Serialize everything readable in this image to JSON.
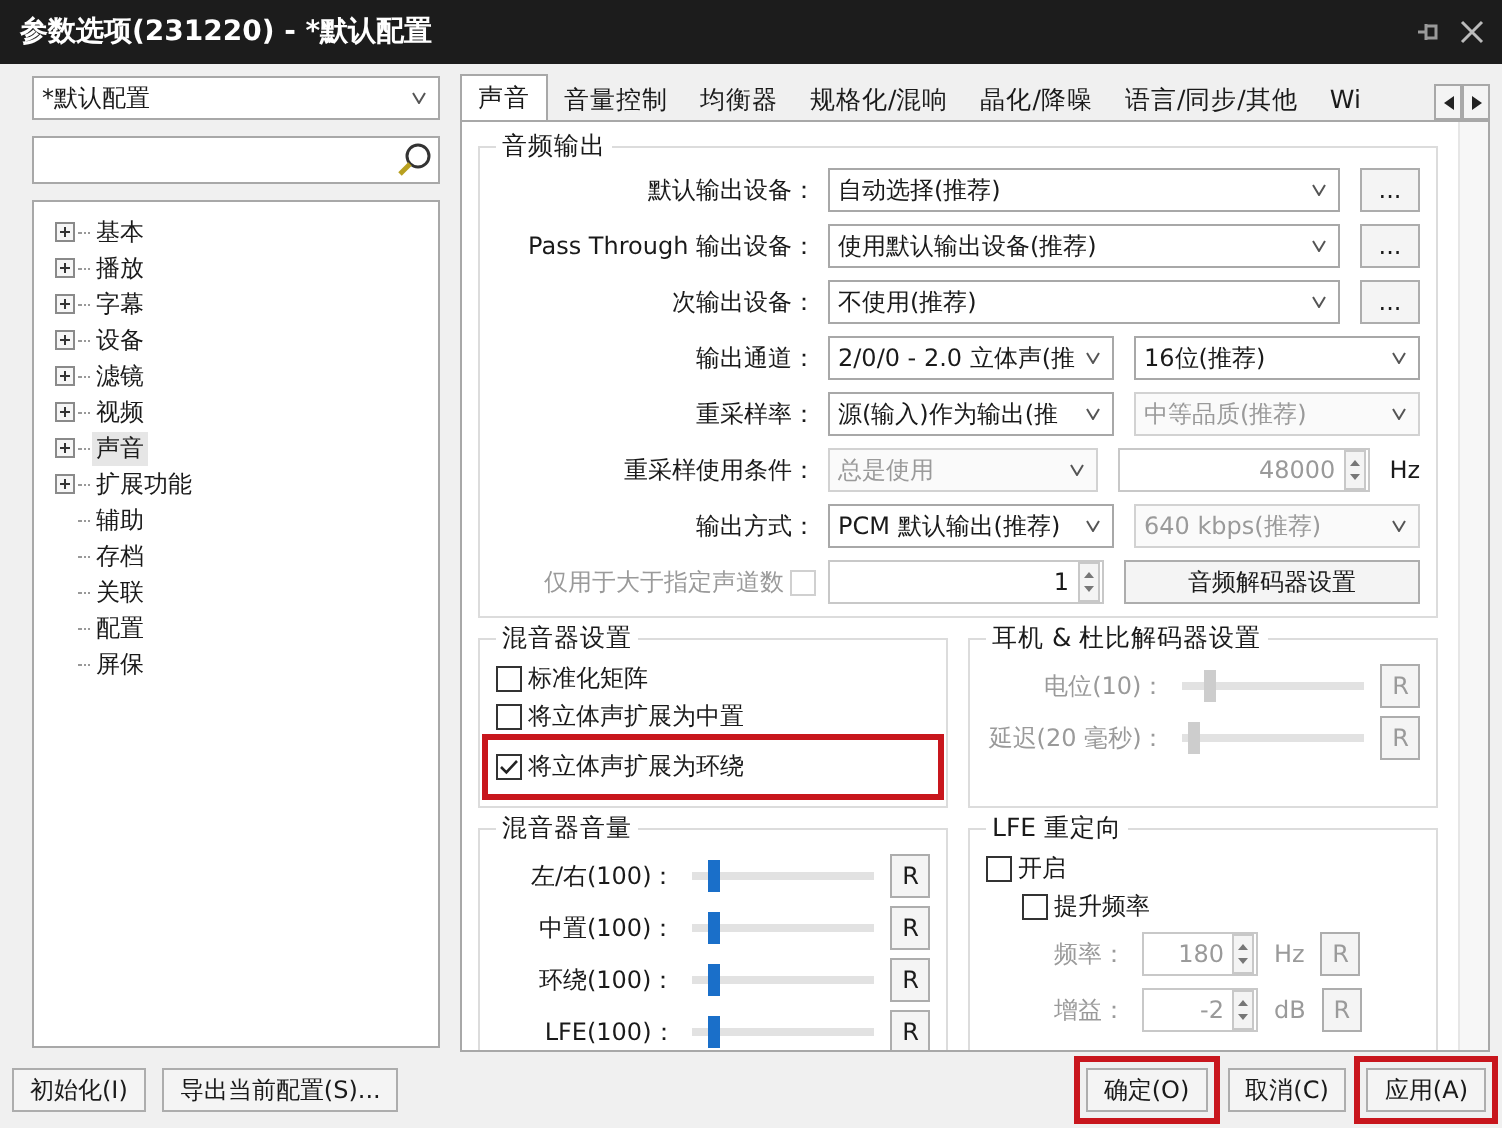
{
  "window": {
    "title": "参数选项(231220) - *默认配置"
  },
  "profile": {
    "value": "*默认配置"
  },
  "tree": [
    {
      "label": "基本",
      "expandable": true,
      "selected": false
    },
    {
      "label": "播放",
      "expandable": true,
      "selected": false
    },
    {
      "label": "字幕",
      "expandable": true,
      "selected": false
    },
    {
      "label": "设备",
      "expandable": true,
      "selected": false
    },
    {
      "label": "滤镜",
      "expandable": true,
      "selected": false
    },
    {
      "label": "视频",
      "expandable": true,
      "selected": false
    },
    {
      "label": "声音",
      "expandable": true,
      "selected": true
    },
    {
      "label": "扩展功能",
      "expandable": true,
      "selected": false
    },
    {
      "label": "辅助",
      "expandable": false,
      "selected": false
    },
    {
      "label": "存档",
      "expandable": false,
      "selected": false
    },
    {
      "label": "关联",
      "expandable": false,
      "selected": false
    },
    {
      "label": "配置",
      "expandable": false,
      "selected": false
    },
    {
      "label": "屏保",
      "expandable": false,
      "selected": false
    }
  ],
  "tabs": [
    {
      "label": "声音",
      "selected": true
    },
    {
      "label": "音量控制",
      "selected": false
    },
    {
      "label": "均衡器",
      "selected": false
    },
    {
      "label": "规格化/混响",
      "selected": false
    },
    {
      "label": "晶化/降噪",
      "selected": false
    },
    {
      "label": "语言/同步/其他",
      "selected": false
    },
    {
      "label": "Wi",
      "selected": false
    }
  ],
  "audio_output": {
    "title": "音频输出",
    "rows": [
      {
        "label": "默认输出设备：",
        "disabled": false,
        "controls": [
          {
            "kind": "combo",
            "value": "自动选择(推荐)",
            "disabled": false
          },
          {
            "kind": "more",
            "text": "...",
            "disabled": false
          }
        ]
      },
      {
        "label": "Pass Through 输出设备：",
        "disabled": false,
        "controls": [
          {
            "kind": "combo",
            "value": "使用默认输出设备(推荐)",
            "disabled": false
          },
          {
            "kind": "more",
            "text": "...",
            "disabled": false
          }
        ]
      },
      {
        "label": "次输出设备：",
        "disabled": false,
        "controls": [
          {
            "kind": "combo",
            "value": "不使用(推荐)",
            "disabled": false
          },
          {
            "kind": "more",
            "text": "...",
            "disabled": false
          }
        ]
      },
      {
        "label": "输出通道：",
        "disabled": false,
        "controls": [
          {
            "kind": "combo",
            "value": "2/0/0 - 2.0 立体声(推",
            "disabled": false
          },
          {
            "kind": "combo",
            "value": "16位(推荐)",
            "disabled": false
          }
        ]
      },
      {
        "label": "重采样率：",
        "disabled": false,
        "controls": [
          {
            "kind": "combo",
            "value": "源(输入)作为输出(推",
            "disabled": false
          },
          {
            "kind": "combo",
            "value": "中等品质(推荐)",
            "disabled": true
          }
        ]
      },
      {
        "label": "重采样使用条件：",
        "disabled": false,
        "controls": [
          {
            "kind": "combo",
            "value": "总是使用",
            "disabled": true
          },
          {
            "kind": "spin",
            "value": "48000",
            "disabled": true
          },
          {
            "kind": "unit",
            "text": "Hz",
            "disabled": false
          }
        ]
      },
      {
        "label": "输出方式：",
        "disabled": false,
        "controls": [
          {
            "kind": "combo",
            "value": "PCM 默认输出(推荐)",
            "disabled": false
          },
          {
            "kind": "combo",
            "value": "640 kbps(推荐)",
            "disabled": true
          }
        ]
      },
      {
        "label": "仅用于大于指定声道数",
        "disabled": true,
        "checkbox": {
          "checked": false,
          "disabled": true
        },
        "controls": [
          {
            "kind": "counter",
            "value": "1",
            "disabled": false
          },
          {
            "kind": "button",
            "text": "音频解码器设置",
            "disabled": false
          }
        ]
      }
    ]
  },
  "mixer_settings": {
    "title": "混音器设置",
    "options": [
      {
        "label": "标准化矩阵",
        "checked": false,
        "highlighted": false
      },
      {
        "label": "将立体声扩展为中置",
        "checked": false,
        "highlighted": false
      },
      {
        "label": "将立体声扩展为环绕",
        "checked": true,
        "highlighted": true
      }
    ]
  },
  "headphone": {
    "title": "耳机 & 杜比解码器设置",
    "sliders": [
      {
        "label": "电位(10)：",
        "level": 0.15,
        "reset": "R",
        "disabled": true
      },
      {
        "label": "延迟(20 毫秒)：",
        "level": 0.07,
        "reset": "R",
        "disabled": true
      }
    ]
  },
  "mixer_volume": {
    "title": "混音器音量",
    "sliders": [
      {
        "label": "左/右(100)：",
        "level": 0.12,
        "reset": "R",
        "disabled": false
      },
      {
        "label": "中置(100)：",
        "level": 0.12,
        "reset": "R",
        "disabled": false
      },
      {
        "label": "环绕(100)：",
        "level": 0.12,
        "reset": "R",
        "disabled": false
      },
      {
        "label": "LFE(100)：",
        "level": 0.12,
        "reset": "R",
        "disabled": false
      }
    ]
  },
  "lfe": {
    "title": "LFE 重定向",
    "options": [
      {
        "label": "开启",
        "checked": false,
        "children": [
          {
            "label": "提升频率",
            "checked": false
          }
        ]
      }
    ],
    "fields": [
      {
        "label": "频率：",
        "value": "180",
        "unit": "Hz",
        "reset": "R",
        "disabled": true
      },
      {
        "label": "增益：",
        "value": "-2",
        "unit": "dB",
        "reset": "R",
        "disabled": true
      }
    ]
  },
  "footer": {
    "left": [
      {
        "label": "初始化(I)",
        "highlighted": false
      },
      {
        "label": "导出当前配置(S)...",
        "highlighted": false
      }
    ],
    "right": [
      {
        "label": "确定(O)",
        "highlighted": true
      },
      {
        "label": "取消(C)",
        "highlighted": false
      },
      {
        "label": "应用(A)",
        "highlighted": true
      }
    ]
  }
}
